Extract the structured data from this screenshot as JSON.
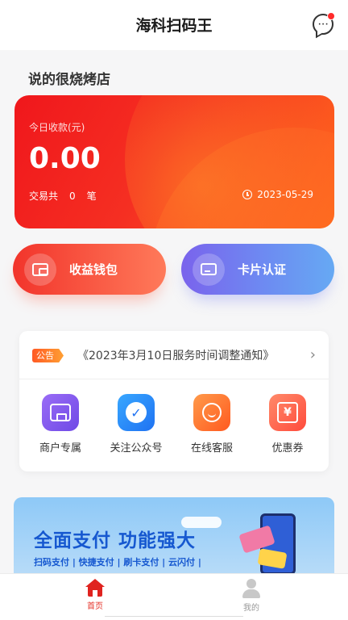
{
  "header": {
    "title": "海科扫码王",
    "chat_icon": "chat-bubble-icon",
    "has_unread": true
  },
  "store": {
    "name": "说的很烧烤店"
  },
  "revenue": {
    "label": "今日收款(元)",
    "amount": "0.00",
    "tx_prefix": "交易共",
    "tx_count": "0",
    "tx_suffix": "笔",
    "date": "2023-05-29"
  },
  "actions": {
    "wallet_label": "收益钱包",
    "card_label": "卡片认证"
  },
  "notice": {
    "tag": "公告",
    "text": "《2023年3月10日服务时间调整通知》",
    "arrow": "›"
  },
  "services": [
    {
      "label": "商户专属",
      "icon": "shop-icon"
    },
    {
      "label": "关注公众号",
      "icon": "verified-badge-icon"
    },
    {
      "label": "在线客服",
      "icon": "customer-service-icon"
    },
    {
      "label": "优惠券",
      "icon": "coupon-icon"
    }
  ],
  "banner": {
    "title": "全面支付 功能强大",
    "subtitle": "扫码支付 | 快捷支付 | 刷卡支付 | 云闪付 |"
  },
  "tabbar": {
    "home_label": "首页",
    "me_label": "我的"
  },
  "colors": {
    "primary_red": "#f0171c",
    "accent_orange": "#ff6a1d",
    "card_purple": "#7a63ec",
    "card_blue": "#66a9f3",
    "tab_active": "#e53228"
  }
}
